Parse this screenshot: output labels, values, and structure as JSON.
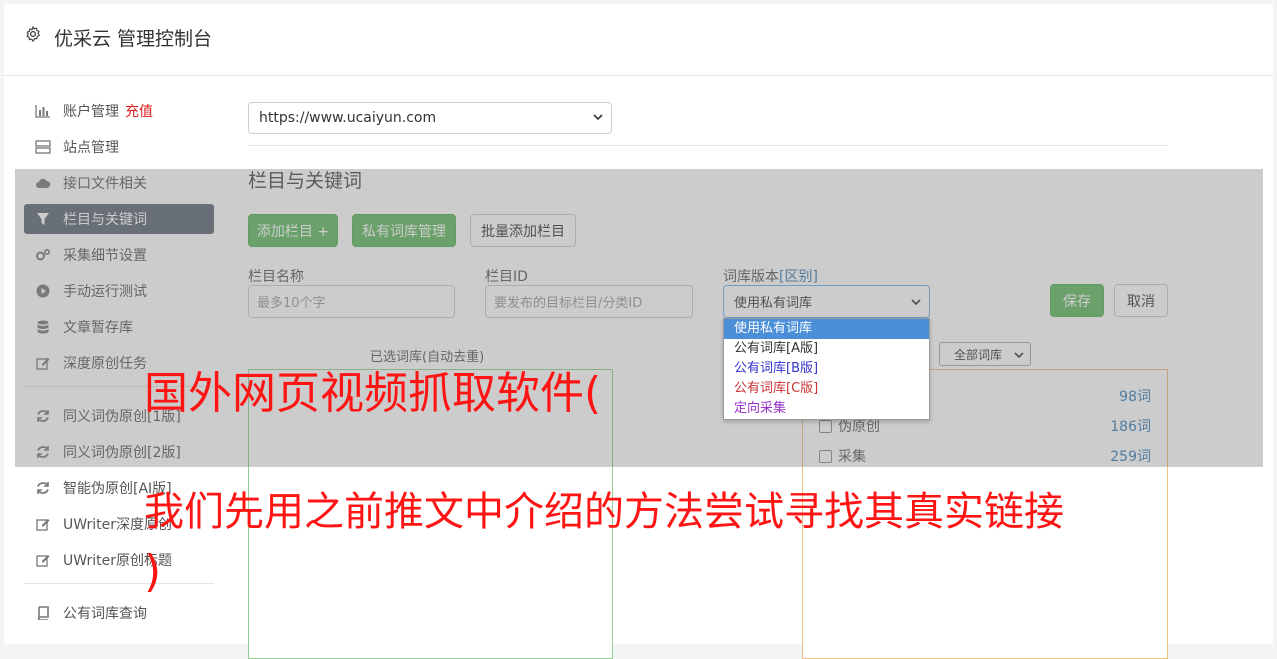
{
  "app": {
    "title": "优采云 管理控制台"
  },
  "sidebar": {
    "items": [
      {
        "label": "账户管理",
        "extra": "充值",
        "icon": "bar-chart-icon"
      },
      {
        "label": "站点管理",
        "icon": "server-icon"
      },
      {
        "label": "接口文件相关",
        "icon": "cloud-upload-icon"
      },
      {
        "label": "栏目与关键词",
        "icon": "filter-icon",
        "active": true
      },
      {
        "label": "采集细节设置",
        "icon": "cogs-icon"
      },
      {
        "label": "手动运行测试",
        "icon": "play-circle-icon"
      },
      {
        "label": "文章暂存库",
        "icon": "database-icon"
      },
      {
        "label": "深度原创任务",
        "icon": "edit-icon"
      },
      {
        "label": "同义词伪原创[1版]",
        "icon": "refresh-icon"
      },
      {
        "label": "同义词伪原创[2版]",
        "icon": "refresh-icon"
      },
      {
        "label": "智能伪原创[AI版]",
        "icon": "refresh-icon"
      },
      {
        "label": "UWriter深度原创",
        "icon": "edit-icon"
      },
      {
        "label": "UWriter原创标题",
        "icon": "edit-icon"
      },
      {
        "label": "公有词库查询",
        "icon": "book-icon"
      }
    ]
  },
  "main": {
    "site_select": "https://www.ucaiyun.com",
    "section_title": "栏目与关键词",
    "buttons": {
      "add_column": "添加栏目 +",
      "private_lib": "私有词库管理",
      "batch_add": "批量添加栏目",
      "save": "保存",
      "cancel": "取消"
    },
    "fields": {
      "name_label": "栏目名称",
      "name_placeholder": "最多10个字",
      "id_label": "栏目ID",
      "id_placeholder": "要发布的目标栏目/分类ID",
      "version_label": "词库版本",
      "version_link": "[区别]",
      "version_value": "使用私有词库"
    },
    "dropdown_options": [
      {
        "label": "使用私有词库",
        "color": "#ffffff"
      },
      {
        "label": "公有词库[A版]",
        "color": "#333333"
      },
      {
        "label": "公有词库[B版]",
        "color": "#3333cc"
      },
      {
        "label": "公有词库[C版]",
        "color": "#cc3333"
      },
      {
        "label": "定向采集",
        "color": "#9933cc"
      }
    ],
    "selected_title": "已选词库(自动去重)",
    "lib_filter": "全部词库",
    "lib_rows": [
      {
        "label": "",
        "count": "98词"
      },
      {
        "label": "伪原创",
        "count": "186词"
      },
      {
        "label": "采集",
        "count": "259词"
      }
    ]
  },
  "overlay_text": {
    "line1": "国外网页视频抓取软件(",
    "line2": "我们先用之前推文中介绍的方法尝试寻找其真实链接",
    "line3": ")"
  }
}
